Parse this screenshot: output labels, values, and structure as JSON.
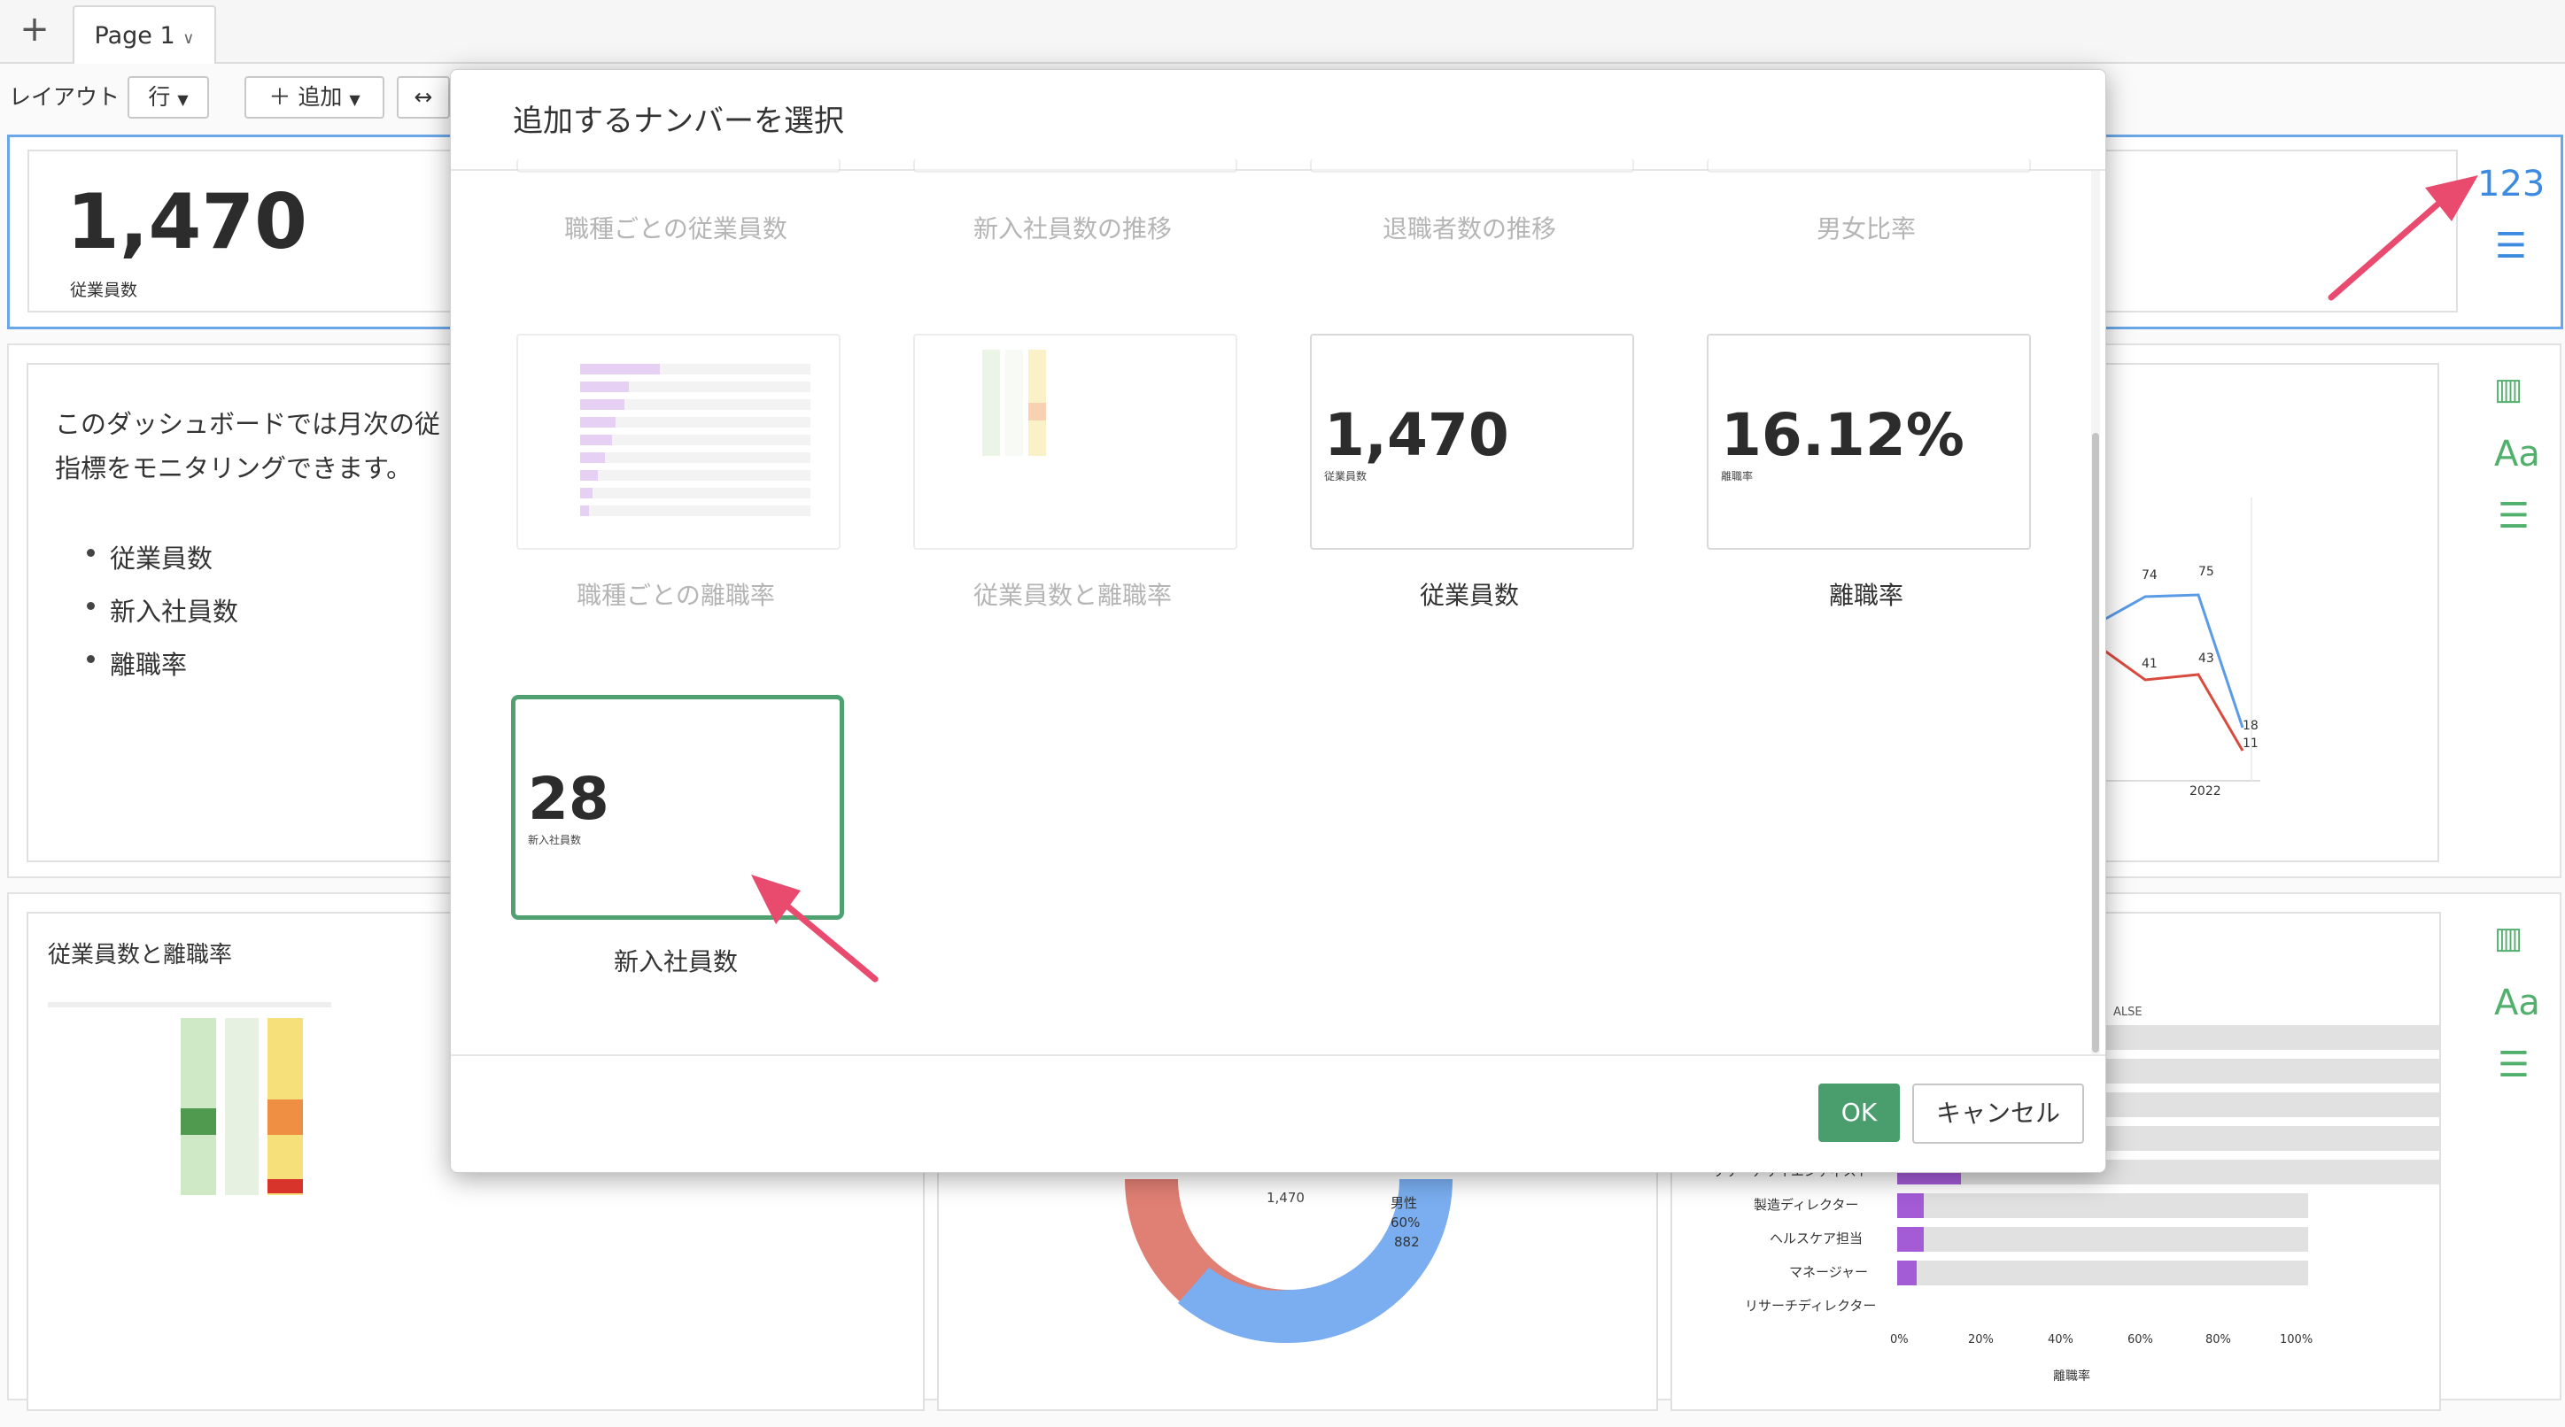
{
  "tabs": {
    "add": "+",
    "page_label": "Page 1"
  },
  "toolbar": {
    "layout_label": "レイアウト",
    "row_button": "行",
    "add_button": "追加",
    "resize_icon": "↔"
  },
  "kpi_panel": {
    "value": "1,470",
    "label": "従業員数",
    "type_icon": "123"
  },
  "text_panel": {
    "line1": "このダッシュボードでは月次の従",
    "line2": "指標をモニタリングできます。",
    "bullets": [
      "従業員数",
      "新入社員数",
      "離職率"
    ]
  },
  "bottom_left_panel": {
    "title": "従業員数と離職率"
  },
  "line_chart": {
    "labels": [
      "74",
      "75",
      "41",
      "43",
      "18",
      "11",
      "2022"
    ]
  },
  "donut": {
    "center": "1,470",
    "male_label": "男性",
    "male_pct": "60%",
    "male_count": "882"
  },
  "bar_panel": {
    "legend_false": "ALSE",
    "categories": [
      "リサーチサイエンティスト",
      "製造ディレクター",
      "ヘルスケア担当",
      "マネージャー",
      "リサーチディレクター"
    ],
    "ticks": [
      "0%",
      "20%",
      "40%",
      "60%",
      "80%",
      "100%"
    ],
    "xlabel": "離職率"
  },
  "side_icons": {
    "chart": "chart-icon",
    "text": "Aa",
    "menu": "menu-icon"
  },
  "modal": {
    "title": "追加するナンバーを選択",
    "row1_captions": [
      "職種ごとの従業員数",
      "新入社員数の推移",
      "退職者数の推移",
      "男女比率"
    ],
    "row2": {
      "captions": [
        "職種ごとの離職率",
        "従業員数と離職率",
        "従業員数",
        "離職率"
      ],
      "card3_value": "1,470",
      "card3_label": "従業員数",
      "card4_value": "16.12%",
      "card4_label": "離職率"
    },
    "row3": {
      "value": "28",
      "label": "新入社員数",
      "caption": "新入社員数"
    },
    "ok": "OK",
    "cancel": "キャンセル"
  },
  "colors": {
    "accent_green": "#4a9e6e",
    "selection_blue": "#6aa7e8",
    "arrow": "#e94b6f"
  }
}
